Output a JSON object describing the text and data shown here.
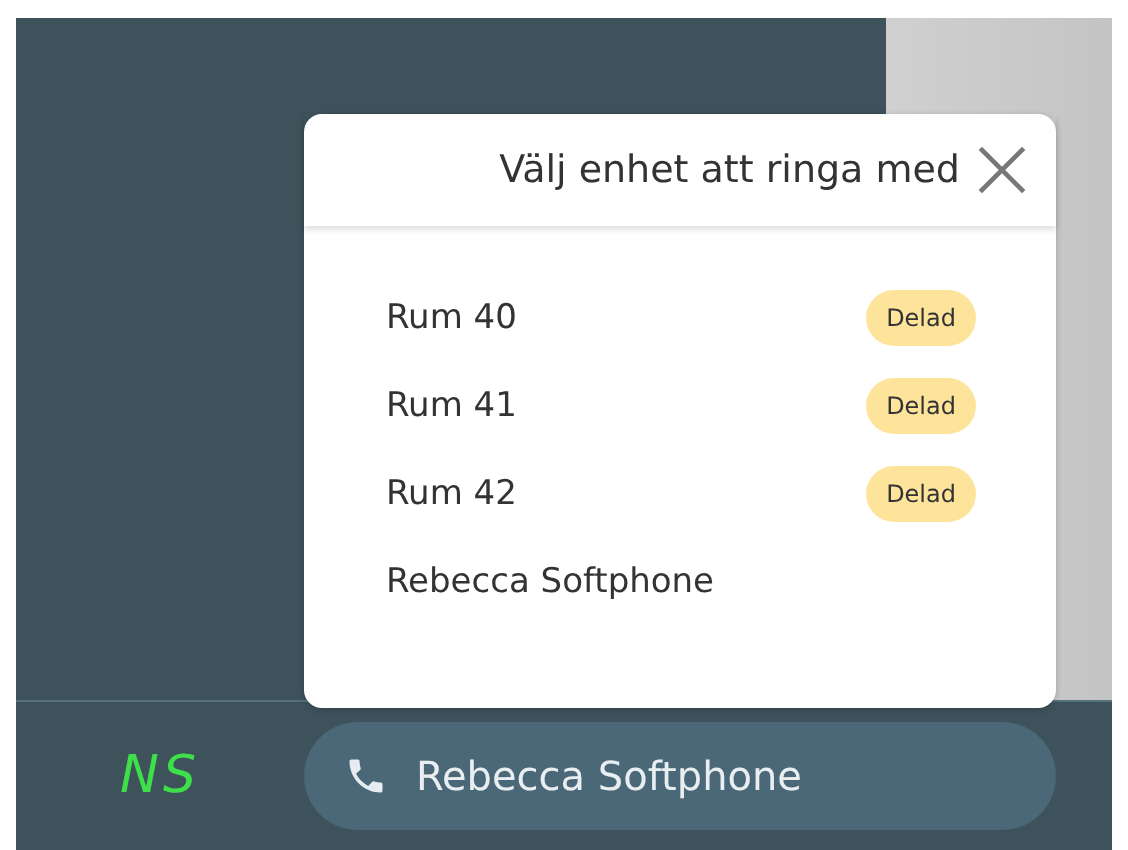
{
  "dialog": {
    "title": "Välj enhet att ringa med",
    "devices": [
      {
        "name": "Rum 40",
        "badge": "Delad"
      },
      {
        "name": "Rum 41",
        "badge": "Delad"
      },
      {
        "name": "Rum 42",
        "badge": "Delad"
      },
      {
        "name": "Rebecca Softphone"
      }
    ]
  },
  "bottom_bar": {
    "logo": "NS",
    "current_device": "Rebecca Softphone"
  }
}
